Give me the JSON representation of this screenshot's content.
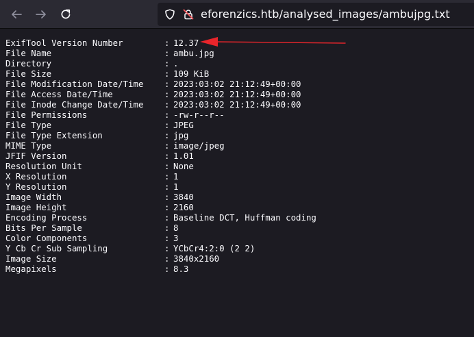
{
  "browser": {
    "url": "eforenzics.htb/analysed_images/ambujpg.txt",
    "icons": {
      "back": "arrow-left-icon",
      "forward": "arrow-right-icon",
      "reload": "reload-icon",
      "site_info": "shield-icon",
      "insecure": "lock-strikethrough-icon"
    }
  },
  "exif": {
    "separator": ":",
    "rows": [
      {
        "key": "ExifTool Version Number",
        "value": "12.37"
      },
      {
        "key": "File Name",
        "value": "ambu.jpg"
      },
      {
        "key": "Directory",
        "value": "."
      },
      {
        "key": "File Size",
        "value": "109 KiB"
      },
      {
        "key": "File Modification Date/Time",
        "value": "2023:03:02 21:12:49+00:00"
      },
      {
        "key": "File Access Date/Time",
        "value": "2023:03:02 21:12:49+00:00"
      },
      {
        "key": "File Inode Change Date/Time",
        "value": "2023:03:02 21:12:49+00:00"
      },
      {
        "key": "File Permissions",
        "value": "-rw-r--r--"
      },
      {
        "key": "File Type",
        "value": "JPEG"
      },
      {
        "key": "File Type Extension",
        "value": "jpg"
      },
      {
        "key": "MIME Type",
        "value": "image/jpeg"
      },
      {
        "key": "JFIF Version",
        "value": "1.01"
      },
      {
        "key": "Resolution Unit",
        "value": "None"
      },
      {
        "key": "X Resolution",
        "value": "1"
      },
      {
        "key": "Y Resolution",
        "value": "1"
      },
      {
        "key": "Image Width",
        "value": "3840"
      },
      {
        "key": "Image Height",
        "value": "2160"
      },
      {
        "key": "Encoding Process",
        "value": "Baseline DCT, Huffman coding"
      },
      {
        "key": "Bits Per Sample",
        "value": "8"
      },
      {
        "key": "Color Components",
        "value": "3"
      },
      {
        "key": "Y Cb Cr Sub Sampling",
        "value": "YCbCr4:2:0 (2 2)"
      },
      {
        "key": "Image Size",
        "value": "3840x2160"
      },
      {
        "key": "Megapixels",
        "value": "8.3"
      }
    ]
  },
  "annotation": {
    "color": "#e8252b",
    "icon": "red-arrow-annotation"
  },
  "theme": {
    "background": "#1c1b22",
    "toolbar": "#2b2a33",
    "text": "#fbfbfe",
    "icon_muted": "#8f8f9d"
  }
}
